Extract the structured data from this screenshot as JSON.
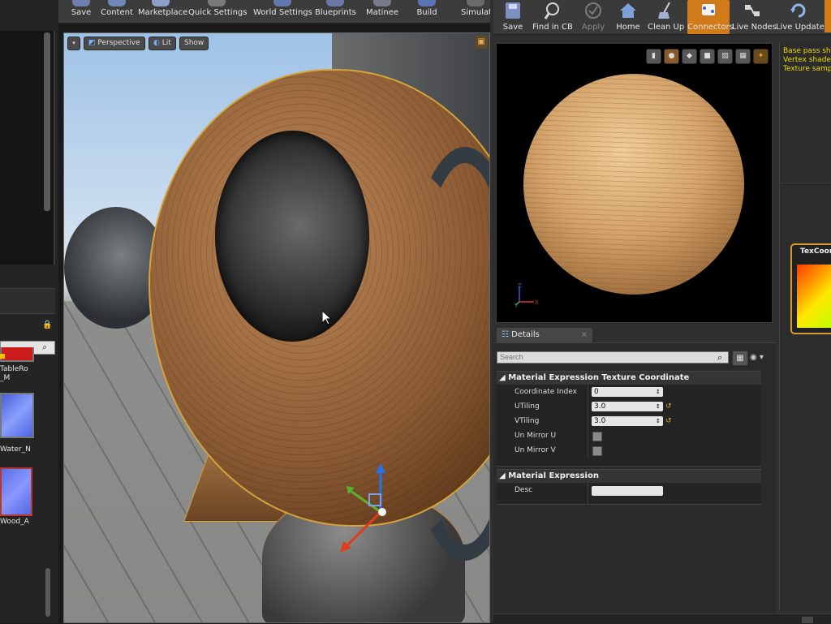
{
  "main_toolbar": {
    "buttons": [
      {
        "label": "Save",
        "icon": "save-icon"
      },
      {
        "label": "Content",
        "icon": "content-icon"
      },
      {
        "label": "Marketplace",
        "icon": "marketplace-icon"
      },
      {
        "label": "Quick Settings",
        "icon": "quick-settings-icon"
      },
      {
        "label": "World Settings",
        "icon": "world-settings-icon"
      },
      {
        "label": "Blueprints",
        "icon": "blueprints-icon"
      },
      {
        "label": "Matinee",
        "icon": "matinee-icon"
      },
      {
        "label": "Build",
        "icon": "build-icon"
      },
      {
        "label": "Simulat",
        "icon": "simulate-icon"
      }
    ]
  },
  "viewport": {
    "view_mode_label": "Perspective",
    "lit_label": "Lit",
    "show_label": "Show"
  },
  "content_browser": {
    "assets": [
      {
        "label": "TableRo\n_M",
        "color": "#cc1d1d"
      },
      {
        "label": "Water_N",
        "color": "#5a74e8"
      },
      {
        "label": "Wood_A",
        "color": "#6a7ef0"
      }
    ],
    "bottom_label": "..."
  },
  "material_toolbar": {
    "buttons": [
      {
        "label": "Save",
        "icon": "save-icon",
        "enabled": true
      },
      {
        "label": "Find in CB",
        "icon": "find-in-cb-icon",
        "enabled": true
      },
      {
        "label": "Apply",
        "icon": "apply-icon",
        "enabled": false
      },
      {
        "label": "Home",
        "icon": "home-icon",
        "enabled": true
      },
      {
        "label": "Clean Up",
        "icon": "clean-up-icon",
        "enabled": true
      },
      {
        "label": "Connectors",
        "icon": "connectors-icon",
        "enabled": true,
        "active": true
      },
      {
        "label": "Live Nodes",
        "icon": "live-nodes-icon",
        "enabled": true
      },
      {
        "label": "Live Update",
        "icon": "live-update-icon",
        "enabled": true
      }
    ]
  },
  "preview": {
    "axis_labels": [
      "Z",
      "Y",
      "X"
    ]
  },
  "details": {
    "tab_label": "Details",
    "search_placeholder": "Search",
    "categories": [
      {
        "title": "Material Expression Texture Coordinate",
        "properties": [
          {
            "name": "Coordinate Index",
            "value": "0"
          },
          {
            "name": "UTiling",
            "value": "3.0"
          },
          {
            "name": "VTiling",
            "value": "3.0"
          },
          {
            "name": "Un Mirror U",
            "checked": false
          },
          {
            "name": "Un Mirror V",
            "checked": false
          }
        ]
      },
      {
        "title": "Material Expression",
        "properties": [
          {
            "name": "Desc",
            "value": ""
          }
        ]
      }
    ]
  },
  "graph": {
    "stats": "Base pass sh\nVertex shader\nTexture samp",
    "node_title": "TexCoor"
  },
  "colors": {
    "accent_orange": "#d07a1a",
    "selection_outline": "#d89a30",
    "stats_text": "#f0dc00",
    "reset_arrow": "#d4b038"
  }
}
